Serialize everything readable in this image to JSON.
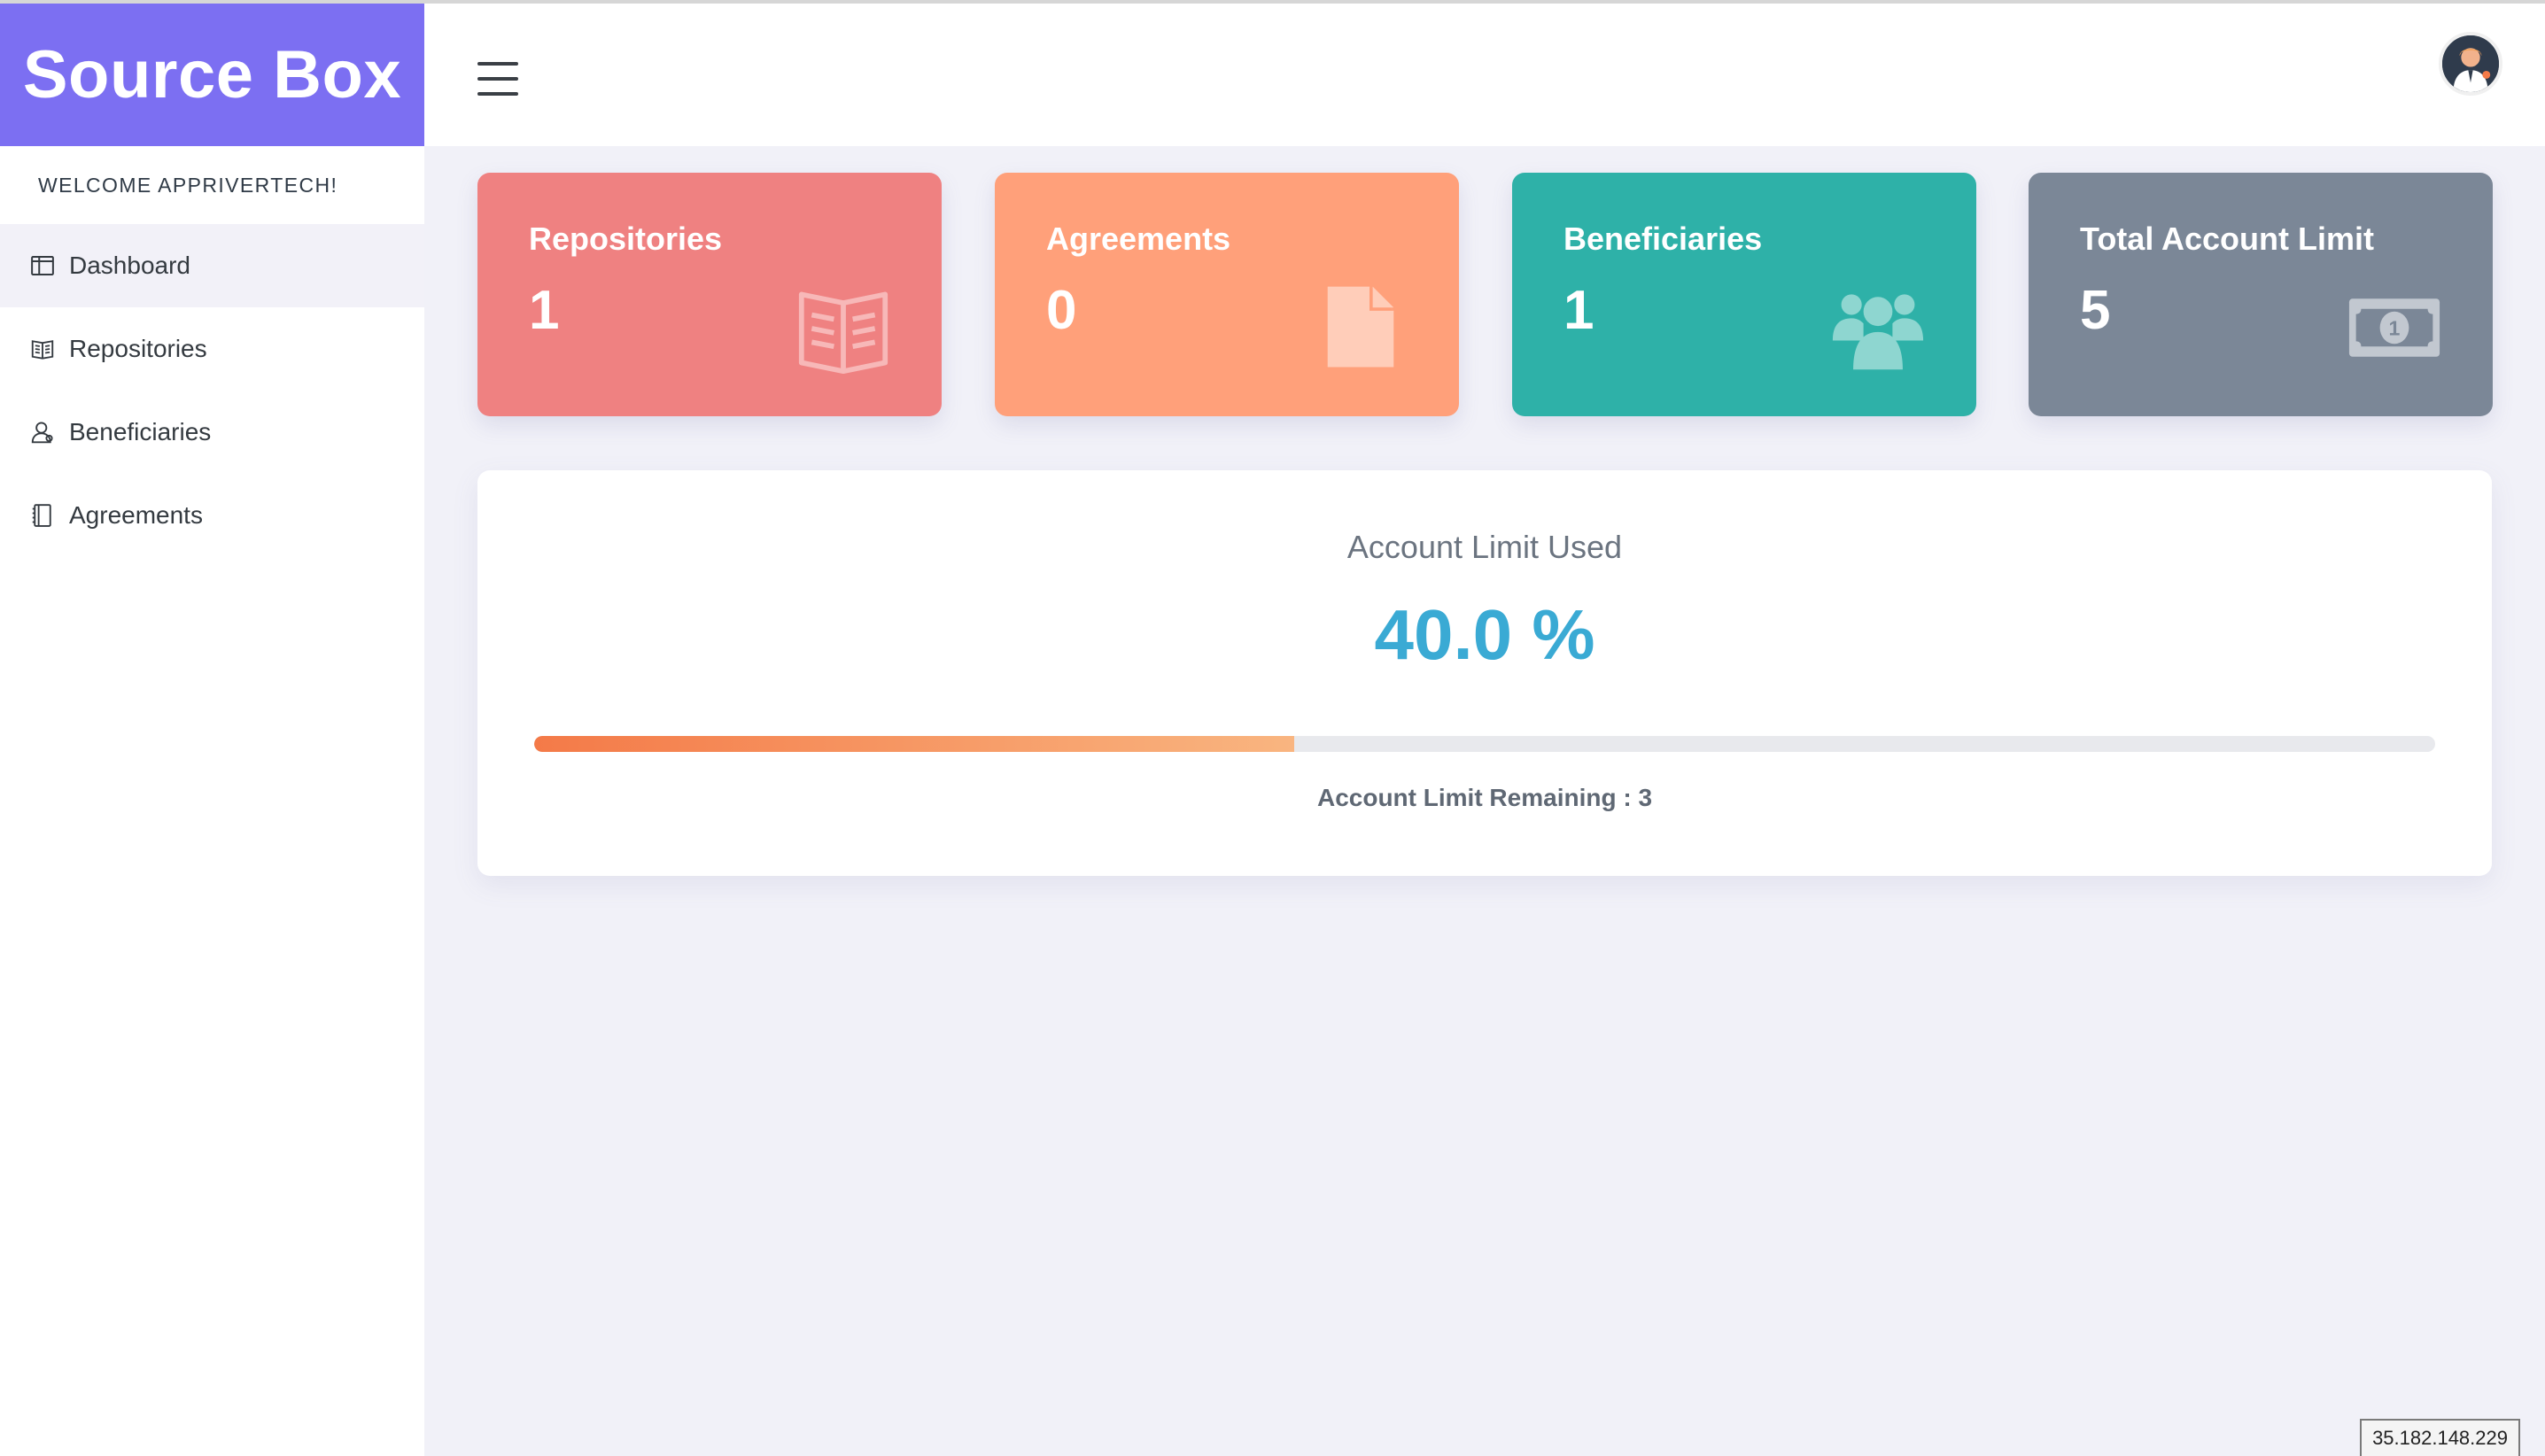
{
  "brand": {
    "name": "Source Box",
    "color": "#7c6ff2"
  },
  "welcome": "WELCOME APPRIVERTECH!",
  "sidebar": {
    "items": [
      {
        "label": "Dashboard",
        "icon": "columns-icon",
        "active": true
      },
      {
        "label": "Repositories",
        "icon": "book-icon",
        "active": false
      },
      {
        "label": "Beneficiaries",
        "icon": "user-icon",
        "active": false
      },
      {
        "label": "Agreements",
        "icon": "notebook-icon",
        "active": false
      }
    ]
  },
  "header": {
    "menu_icon": "hamburger-icon",
    "avatar_icon": "user-avatar-icon"
  },
  "cards": [
    {
      "title": "Repositories",
      "value": "1",
      "icon": "open-book-icon",
      "color": "#ef8181"
    },
    {
      "title": "Agreements",
      "value": "0",
      "icon": "file-icon",
      "color": "#ffa07a"
    },
    {
      "title": "Beneficiaries",
      "value": "1",
      "icon": "users-icon",
      "color": "#2eb1a8"
    },
    {
      "title": "Total Account Limit",
      "value": "5",
      "icon": "money-bill-icon",
      "color": "#7b8797"
    }
  ],
  "usage": {
    "title": "Account Limit Used",
    "percent_text": "40.0 %",
    "percent_value": 40.0,
    "remaining_text": "Account Limit Remaining : 3"
  },
  "ip_address": "35.182.148.229"
}
